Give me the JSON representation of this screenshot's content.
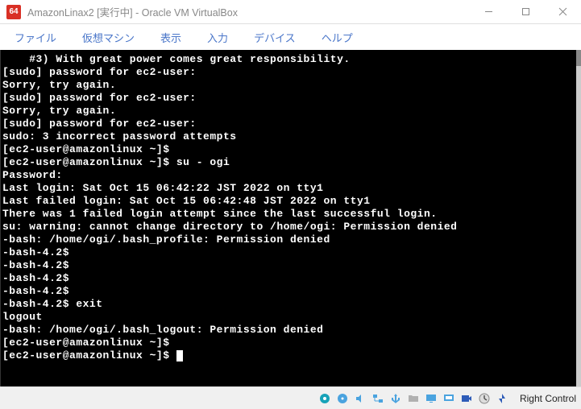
{
  "window": {
    "title": "AmazonLinax2 [実行中] - Oracle VM VirtualBox"
  },
  "menu": {
    "file": "ファイル",
    "machine": "仮想マシン",
    "view": "表示",
    "input": "入力",
    "devices": "デバイス",
    "help": "ヘルプ"
  },
  "terminal_lines": [
    "    #3) With great power comes great responsibility.",
    "",
    "[sudo] password for ec2-user:",
    "Sorry, try again.",
    "[sudo] password for ec2-user:",
    "Sorry, try again.",
    "[sudo] password for ec2-user:",
    "sudo: 3 incorrect password attempts",
    "[ec2-user@amazonlinux ~]$",
    "[ec2-user@amazonlinux ~]$ su - ogi",
    "Password:",
    "Last login: Sat Oct 15 06:42:22 JST 2022 on tty1",
    "Last failed login: Sat Oct 15 06:42:48 JST 2022 on tty1",
    "There was 1 failed login attempt since the last successful login.",
    "su: warning: cannot change directory to /home/ogi: Permission denied",
    "-bash: /home/ogi/.bash_profile: Permission denied",
    "-bash-4.2$",
    "-bash-4.2$",
    "-bash-4.2$",
    "-bash-4.2$",
    "-bash-4.2$ exit",
    "logout",
    "-bash: /home/ogi/.bash_logout: Permission denied",
    "[ec2-user@amazonlinux ~]$",
    "[ec2-user@amazonlinux ~]$ "
  ],
  "status": {
    "host_key": "Right Control"
  },
  "icons": {
    "hdd": "hdd-icon",
    "disc": "disc-icon",
    "audio": "audio-icon",
    "net": "network-icon",
    "usb": "usb-icon",
    "folder": "folder-icon",
    "display": "display-icon",
    "display2": "display2-icon",
    "rec": "recording-icon",
    "cpu": "cpu-icon",
    "mouse": "mouse-icon",
    "keyboard": "keyboard-icon"
  }
}
